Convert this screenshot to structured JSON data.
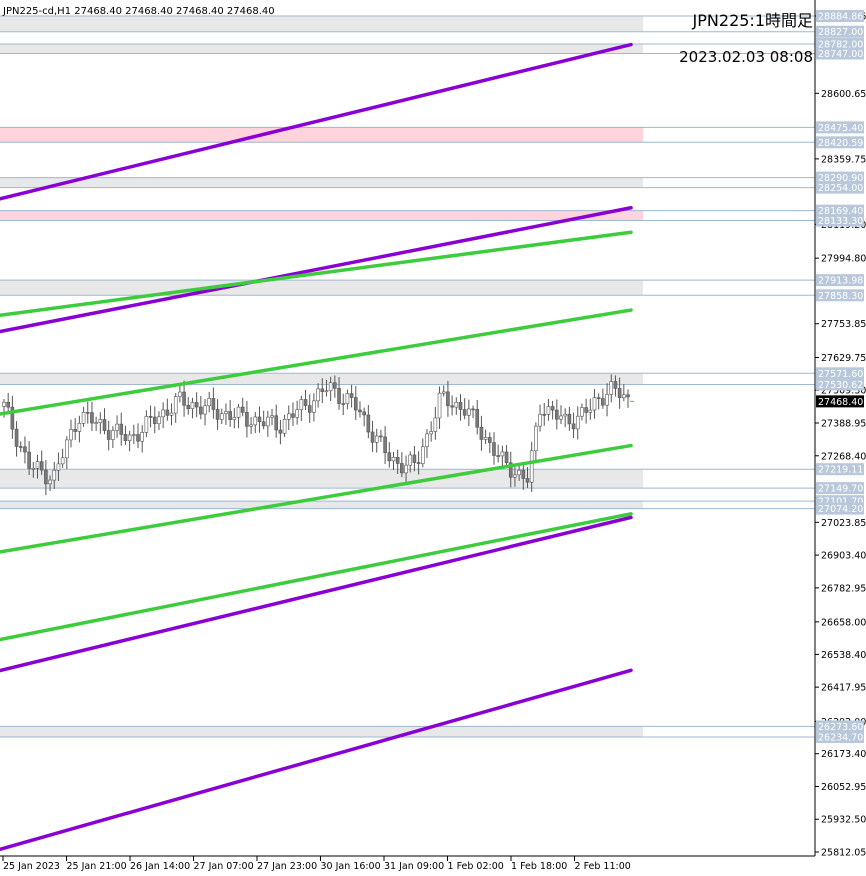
{
  "window": {
    "header": "JPN225-cd,H1  27468.40 27468.40 27468.40 27468.40",
    "title_jp": "JPN225:1時間足",
    "datetime": "2023.02.03 08:08"
  },
  "colors": {
    "purple": "#8a00d4",
    "green": "#3ccc3c",
    "pink_zone": "#ffd4dc",
    "gray_zone": "#e8e8e8",
    "hline": "#9fb7cf",
    "tag_bg": "#b8c8da",
    "candle_up": "#ffffff",
    "candle_down": "#7a7a7a",
    "current_tag_bg": "#000000",
    "current_tag_fg": "#ffffff"
  },
  "chart_data": {
    "type": "candlestick",
    "x_labels": [
      "25 Jan 2023",
      "25 Jan 21:00",
      "26 Jan 14:00",
      "27 Jan 07:00",
      "27 Jan 23:00",
      "30 Jan 16:00",
      "31 Jan 09:00",
      "1 Feb 02:00",
      "1 Feb 18:00",
      "2 Feb 11:00"
    ],
    "y_ticks": [
      "28884.86",
      "28600.65",
      "28359.75",
      "28119.20",
      "27994.80",
      "27753.85",
      "27629.75",
      "27509.30",
      "27388.95",
      "27268.40",
      "27023.85",
      "26903.40",
      "26782.95",
      "26658.00",
      "26538.40",
      "26417.95",
      "26292.00",
      "26173.40",
      "26052.95",
      "25932.50",
      "25812.05"
    ],
    "y_range": [
      25812.05,
      28884.86
    ],
    "current_price": "27468.40",
    "levels": [
      "28884.86",
      "28827.00",
      "28782.00",
      "28747.00",
      "28475.40",
      "28420.59",
      "28290.90",
      "28254.00",
      "28169.40",
      "28133.30",
      "27913.98",
      "27858.30",
      "27571.60",
      "27530.62",
      "27219.11",
      "27149.70",
      "27101.70",
      "27074.20",
      "26273.60",
      "26234.70"
    ],
    "zones": [
      {
        "top": 28884.86,
        "bottom": 28827.0,
        "kind": "gray"
      },
      {
        "top": 28782.0,
        "bottom": 28747.0,
        "kind": "gray"
      },
      {
        "top": 28475.4,
        "bottom": 28420.59,
        "kind": "pink"
      },
      {
        "top": 28290.9,
        "bottom": 28254.0,
        "kind": "gray"
      },
      {
        "top": 28169.4,
        "bottom": 28133.3,
        "kind": "pink"
      },
      {
        "top": 27913.98,
        "bottom": 27858.3,
        "kind": "gray"
      },
      {
        "top": 27571.6,
        "bottom": 27530.62,
        "kind": "gray"
      },
      {
        "top": 27219.11,
        "bottom": 27149.7,
        "kind": "gray"
      },
      {
        "top": 27101.7,
        "bottom": 27074.2,
        "kind": "gray"
      },
      {
        "top": 26273.6,
        "bottom": 26234.7,
        "kind": "gray"
      }
    ],
    "trendlines": [
      {
        "color": "purple",
        "x1": 0,
        "y1": 28213,
        "x2": 1,
        "y2": 28780
      },
      {
        "color": "purple",
        "x1": 0,
        "y1": 27725,
        "x2": 1,
        "y2": 28180
      },
      {
        "color": "purple",
        "x1": 0,
        "y1": 26479,
        "x2": 1,
        "y2": 27042
      },
      {
        "color": "purple",
        "x1": 0,
        "y1": 25822,
        "x2": 1,
        "y2": 26480
      },
      {
        "color": "green",
        "x1": 0,
        "y1": 27785,
        "x2": 1,
        "y2": 28090
      },
      {
        "color": "green",
        "x1": 0,
        "y1": 27422,
        "x2": 1,
        "y2": 27804
      },
      {
        "color": "green",
        "x1": 0,
        "y1": 26915,
        "x2": 1,
        "y2": 27306
      },
      {
        "color": "green",
        "x1": 0,
        "y1": 26593,
        "x2": 1,
        "y2": 27055
      }
    ]
  }
}
